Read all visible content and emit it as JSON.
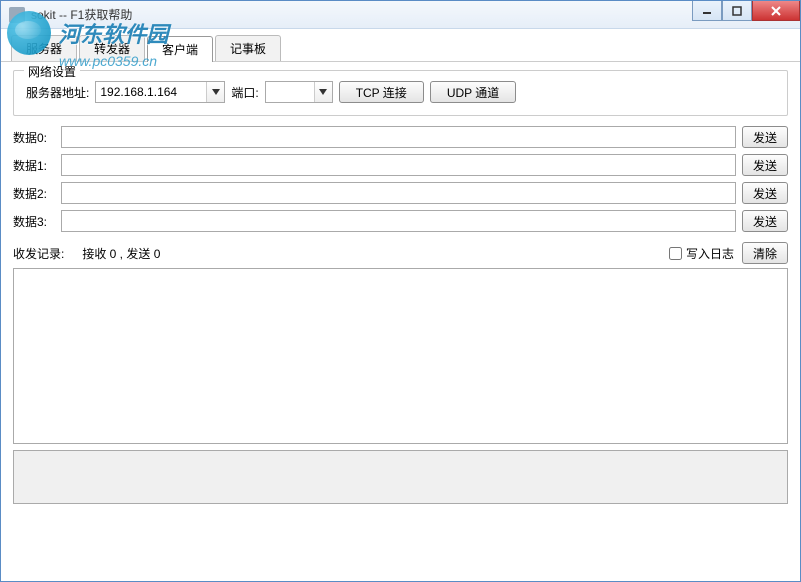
{
  "window": {
    "title": "sokit -- F1获取帮助"
  },
  "watermark": {
    "text": "河东软件园",
    "url": "www.pc0359.cn"
  },
  "tabs": [
    {
      "label": "服务器"
    },
    {
      "label": "转发器"
    },
    {
      "label": "客户端"
    },
    {
      "label": "记事板"
    }
  ],
  "network": {
    "legend": "网络设置",
    "addressLabel": "服务器地址:",
    "addressValue": "192.168.1.164",
    "portLabel": "端口:",
    "portValue": "",
    "tcpButton": "TCP 连接",
    "udpButton": "UDP 通道"
  },
  "dataRows": [
    {
      "label": "数据0:",
      "value": "",
      "send": "发送"
    },
    {
      "label": "数据1:",
      "value": "",
      "send": "发送"
    },
    {
      "label": "数据2:",
      "value": "",
      "send": "发送"
    },
    {
      "label": "数据3:",
      "value": "",
      "send": "发送"
    }
  ],
  "stats": {
    "label": "收发记录:",
    "text": "接收 0 , 发送 0",
    "writeLogLabel": "写入日志",
    "clearButton": "清除"
  }
}
